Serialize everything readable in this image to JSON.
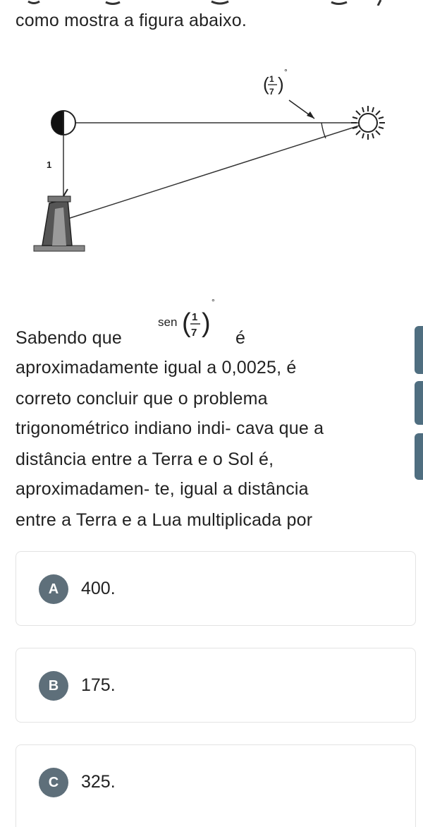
{
  "intro": "como mostra a figura abaixo.",
  "figure": {
    "angle_label": "1",
    "angle_denominator": "7",
    "angle_degree": "°",
    "side_label": "1"
  },
  "question": {
    "line1_before": "Sabendo que",
    "formula_func": "sen",
    "formula_num": "1",
    "formula_den": "7",
    "formula_degree": "°",
    "line1_after": "é",
    "line2": "aproximadamente igual a 0,0025, é",
    "line3": "correto concluir que o problema",
    "line4": "trigonométrico indiano indi- cava que a",
    "line5": "distância entre a Terra e o Sol é,",
    "line6": "aproximadamen- te, igual a distância",
    "line7": "entre a Terra e a Lua multiplicada por"
  },
  "options": [
    {
      "letter": "A",
      "text": "400."
    },
    {
      "letter": "B",
      "text": "175."
    },
    {
      "letter": "C",
      "text": "325."
    }
  ],
  "colors": {
    "badge": "#5e6f7a",
    "side_tab": "#4f6e80",
    "border": "#e3e3e3"
  }
}
